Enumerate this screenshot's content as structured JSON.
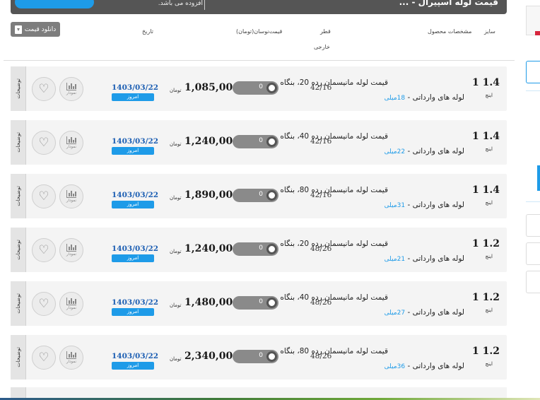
{
  "banner": {
    "title": "قیمت لوله اسپیرال - ...",
    "note": "افزوده می باشد."
  },
  "header": {
    "download_label": "دانلود قیمت",
    "col_date": "تاریخ",
    "col_price": "قیمت‌نوسان(تومان)",
    "col_diameter_line1": "قطر",
    "col_diameter_line2": "خارجی",
    "col_spec": "مشخصات محصول",
    "col_size": "سایز"
  },
  "common": {
    "side_tab": "توضیحات",
    "chart_label": "نمودار",
    "today_label": "امروز",
    "currency": "تومان",
    "size_unit": "اینچ",
    "mm_unit": "میلی"
  },
  "rows": [
    {
      "size": "1 1.4",
      "title": "قیمت لوله مانیسمان رده 20، بنگاه",
      "sub": "لوله های وارداتی - ",
      "weight": "18",
      "diameter": "42/16",
      "oscillation": "0",
      "price": "1,085,000",
      "date": "1403/03/22"
    },
    {
      "size": "1 1.4",
      "title": "قیمت لوله مانیسمان رده 40، بنگاه",
      "sub": "لوله های وارداتی - ",
      "weight": "22",
      "diameter": "42/16",
      "oscillation": "0",
      "price": "1,240,000",
      "date": "1403/03/22"
    },
    {
      "size": "1 1.4",
      "title": "قیمت لوله مانیسمان رده 80، بنگاه",
      "sub": "لوله های وارداتی - ",
      "weight": "31",
      "diameter": "42/16",
      "oscillation": "0",
      "price": "1,890,000",
      "date": "1403/03/22"
    },
    {
      "size": "1 1.2",
      "title": "قیمت لوله مانیسمان رده 20، بنگاه",
      "sub": "لوله های وارداتی - ",
      "weight": "21",
      "diameter": "48/26",
      "oscillation": "0",
      "price": "1,240,000",
      "date": "1403/03/22"
    },
    {
      "size": "1 1.2",
      "title": "قیمت لوله مانیسمان رده 40، بنگاه",
      "sub": "لوله های وارداتی - ",
      "weight": "27",
      "diameter": "48/26",
      "oscillation": "0",
      "price": "1,480,000",
      "date": "1403/03/22"
    },
    {
      "size": "1 1.2",
      "title": "قیمت لوله مانیسمان رده 80، بنگاه",
      "sub": "لوله های وارداتی - ",
      "weight": "36",
      "diameter": "48/26",
      "oscillation": "0",
      "price": "2,340,000",
      "date": "1403/03/22"
    }
  ],
  "colors": {
    "accent_blue": "#1e9be8",
    "date_blue": "#1d5fb3",
    "toggle_gray": "#8a8a8a",
    "row_bg": "#f4f4f4",
    "banner_bg": "#555555"
  },
  "icons": [
    "heart-icon",
    "bar-chart-icon",
    "download-icon"
  ]
}
